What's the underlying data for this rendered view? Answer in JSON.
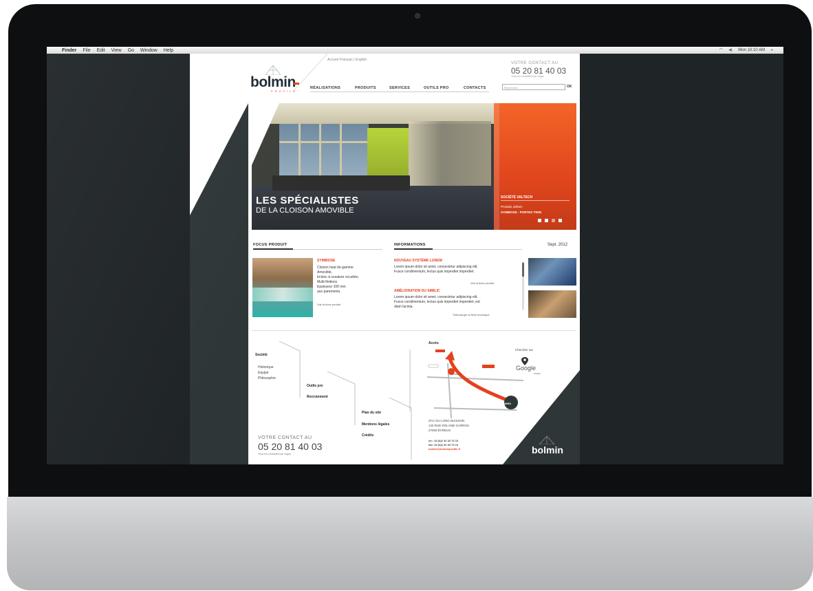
{
  "menubar": {
    "items": [
      "Finder",
      "File",
      "Edit",
      "View",
      "Go",
      "Window",
      "Help"
    ],
    "clock": "Mon 10:10 AM"
  },
  "site": {
    "logo": "bolmin",
    "logo_sub": "PROFILE",
    "top_links": "Accueil   Français | English",
    "nav": [
      "RÉALISATIONS",
      "PRODUITS",
      "SERVICES",
      "OUTILS PRO",
      "CONTACTS"
    ],
    "contact_label": "VOTRE CONTACT AU",
    "contact_phone": "05 20 81 40 03",
    "contact_note": "Tous nos conseillers par région",
    "search_placeholder": "Recherche",
    "search_ok": "OK"
  },
  "hero": {
    "title": "LES SPÉCIALISTES",
    "subtitle": "DE LA CLOISON AMOVIBLE",
    "company": "SOCIÉTÉ VALTECH",
    "products_label": "Produits utilisés",
    "products": "SYMBIOSE - PORTES TWIN",
    "slides": 4
  },
  "focus": {
    "title": "FOCUS PRODUIT",
    "product_name": "SYMBIOSE",
    "lines": [
      "Cloison haut de gamme",
      "Amovible,",
      "bi-bloc à ossature occultée,",
      "Multi-finitions",
      "Epaisseur 100 mm",
      "aux parements."
    ],
    "link": "Voir la fiche produit"
  },
  "informations": {
    "title": "INFORMATIONS",
    "date": "Sept. 2012",
    "item1_title": "NOUVEAU SYSTÈME LOREM",
    "item1_text1": "Lorem ipsum dolor sit amet, consectetur adipiscing elit.",
    "item1_text2": "Fusce condimentum, lectus quis imperdiet imperdiet.",
    "item1_link": "Voir la fiche produit",
    "item2_title": "AMÉLIORATION DU SIMILIC",
    "item2_text1": "Lorem ipsum dolor sit amet, consectetur adipiscing elit.",
    "item2_text2": "Fusce condimentum, lectus quis imperdiet imperdiet, est",
    "item2_text3": "diam lacinia.",
    "item2_link": "Télécharger la fiche technique"
  },
  "footer": {
    "societe": "Société",
    "societe_items": [
      "Historique",
      "Equipe",
      "Philosophie"
    ],
    "outils": "Outils pro",
    "recrutement": "Recrutement",
    "plan": "Plan du site",
    "mentions": "Mentions légales",
    "credits": "Crédits",
    "acces": "Accès",
    "chercher": "Chercher sur",
    "google": "Google",
    "maps": "maps",
    "address": [
      "ZAC DU LONG BUISSON",
      "140 RUE ROLAND GARROS",
      "27000 ÉVREUX"
    ],
    "tel": "tel.: 33 (0)2 32 33 73 13",
    "fax": "fax: 33 (0)2 32 33 73 13",
    "email": "bolmin@bolminprofile.fr",
    "contact_label": "VOTRE CONTACT AU",
    "contact_phone": "05 20 81 40 03",
    "contact_note": "Tous nos conseillers par région",
    "map_paris": "PARIS",
    "map_evreux": "EVREUX",
    "logo": "bolmin"
  },
  "colors": {
    "accent": "#e4421e",
    "dark": "#2e3638",
    "bezel": "#0d0f10"
  }
}
